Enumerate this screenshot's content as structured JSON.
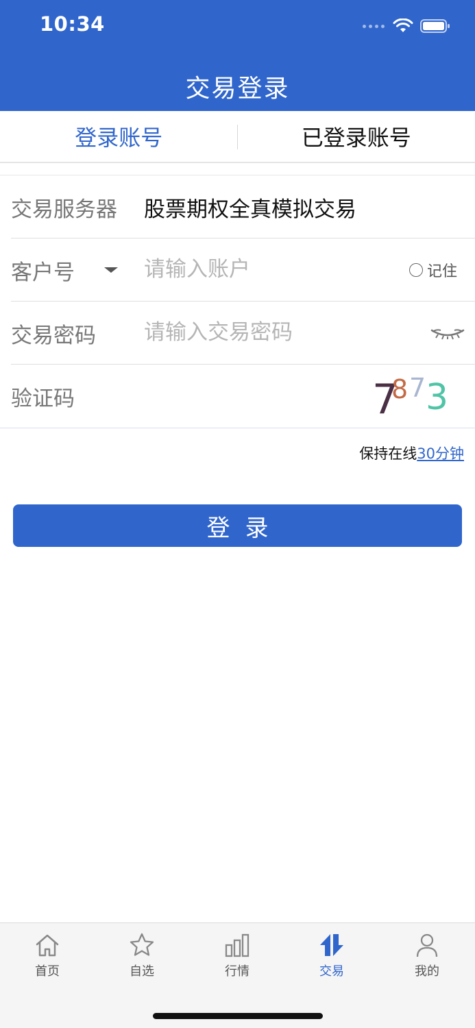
{
  "status_bar": {
    "time": "10:34"
  },
  "header": {
    "title": "交易登录"
  },
  "tabs": [
    {
      "label": "登录账号",
      "active": true
    },
    {
      "label": "已登录账号",
      "active": false
    }
  ],
  "form": {
    "server": {
      "label": "交易服务器",
      "value": "股票期权全真模拟交易"
    },
    "account": {
      "label": "客户号",
      "placeholder": "请输入账户",
      "remember_label": "记住"
    },
    "password": {
      "label": "交易密码",
      "placeholder": "请输入交易密码"
    },
    "captcha": {
      "label": "验证码",
      "digits": [
        "7",
        "8",
        "7",
        "3"
      ]
    }
  },
  "keep_online": {
    "prefix": "保持在线",
    "duration": "30分钟"
  },
  "login_button": {
    "label": "登录"
  },
  "tabbar": {
    "items": [
      {
        "label": "首页",
        "icon": "home-icon"
      },
      {
        "label": "自选",
        "icon": "star-icon"
      },
      {
        "label": "行情",
        "icon": "bar-chart-icon"
      },
      {
        "label": "交易",
        "icon": "trade-icon",
        "active": true
      },
      {
        "label": "我的",
        "icon": "person-icon"
      }
    ]
  },
  "colors": {
    "brand": "#3066cc",
    "placeholder": "#b5b5b5"
  }
}
